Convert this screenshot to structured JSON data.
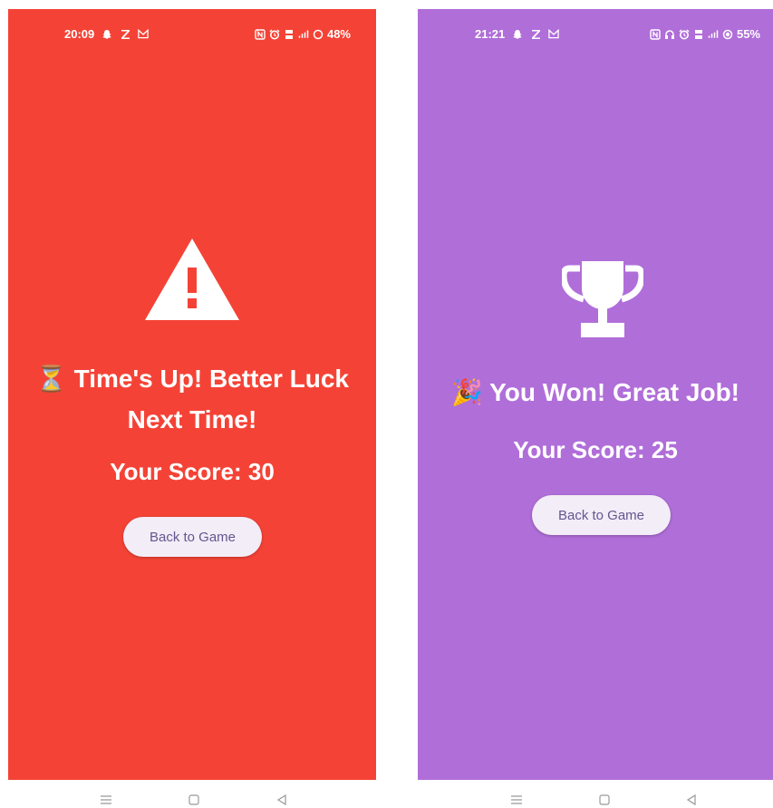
{
  "screens": [
    {
      "status_bar": {
        "time": "20:09",
        "battery": "48%"
      },
      "hero_icon": "warning-triangle-icon",
      "message_emoji": "⏳",
      "message_text": "Time's Up! Better Luck Next Time!",
      "score_text": "Your Score: 30",
      "button_label": "Back to Game",
      "background_color": "#f44336"
    },
    {
      "status_bar": {
        "time": "21:21",
        "battery": "55%"
      },
      "hero_icon": "trophy-icon",
      "message_emoji": "🎉",
      "message_text": "You Won! Great Job!",
      "score_text": "Your Score: 25",
      "button_label": "Back to Game",
      "background_color": "#b06ed9"
    }
  ],
  "nav_bar": {
    "icons": [
      "menu-icon",
      "home-icon",
      "back-icon"
    ]
  },
  "colors": {
    "button_background": "#f3edf7",
    "button_text": "#65558f"
  }
}
